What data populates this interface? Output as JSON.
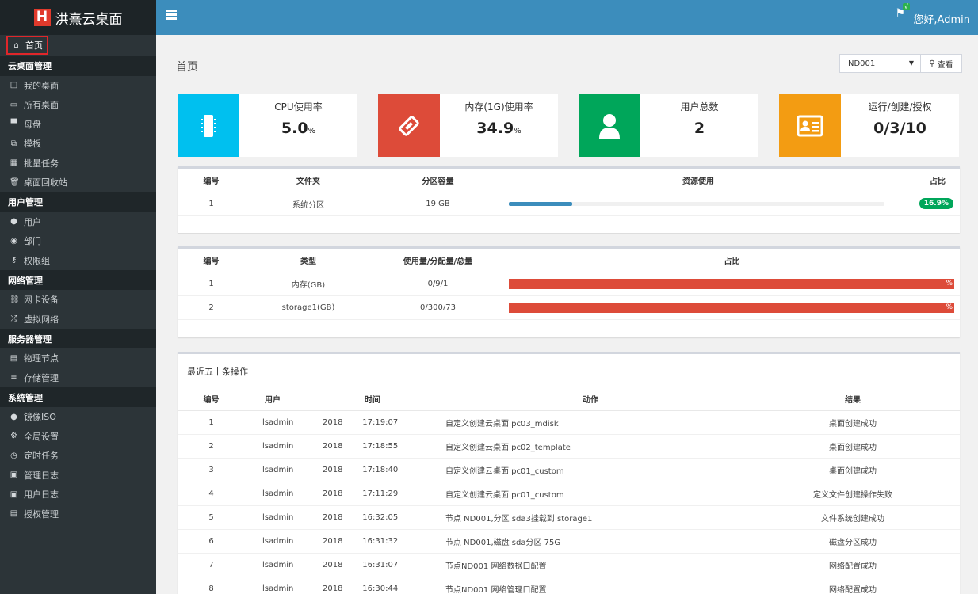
{
  "brand": {
    "logo": "H",
    "name": "洪熹云桌面"
  },
  "sidebar": {
    "home": "首页",
    "groups": [
      {
        "title": "云桌面管理",
        "items": [
          {
            "icon": "□",
            "label": "我的桌面"
          },
          {
            "icon": "▭",
            "label": "所有桌面"
          },
          {
            "icon": "▀",
            "label": "母盘"
          },
          {
            "icon": "⧉",
            "label": "模板"
          },
          {
            "icon": "▦",
            "label": "批量任务"
          },
          {
            "icon": "🗑",
            "label": "桌面回收站"
          }
        ]
      },
      {
        "title": "用户管理",
        "items": [
          {
            "icon": "●",
            "label": "用户"
          },
          {
            "icon": "◉",
            "label": "部门"
          },
          {
            "icon": "⚷",
            "label": "权限组"
          }
        ]
      },
      {
        "title": "网络管理",
        "items": [
          {
            "icon": "⛓",
            "label": "网卡设备"
          },
          {
            "icon": "⤮",
            "label": "虚拟网络"
          }
        ]
      },
      {
        "title": "服务器管理",
        "items": [
          {
            "icon": "▤",
            "label": "物理节点"
          },
          {
            "icon": "≡",
            "label": "存储管理"
          }
        ]
      },
      {
        "title": "系统管理",
        "items": [
          {
            "icon": "●",
            "label": "镜像ISO"
          },
          {
            "icon": "⚙",
            "label": "全局设置"
          },
          {
            "icon": "◷",
            "label": "定时任务"
          },
          {
            "icon": "▣",
            "label": "管理日志"
          },
          {
            "icon": "▣",
            "label": "用户日志"
          },
          {
            "icon": "▤",
            "label": "授权管理"
          }
        ]
      }
    ]
  },
  "topbar": {
    "greeting": "您好,Admin",
    "badge": "√"
  },
  "page": {
    "title": "首页",
    "node": "ND001",
    "view_button": "查看"
  },
  "stats": {
    "cpu": {
      "label": "CPU使用率",
      "value": "5.0",
      "unit": "%"
    },
    "mem": {
      "label": "内存(1G)使用率",
      "value": "34.9",
      "unit": "%"
    },
    "users": {
      "label": "用户总数",
      "value": "2"
    },
    "desktops": {
      "label": "运行/创建/授权",
      "value": "0/3/10"
    }
  },
  "colors": {
    "cpu": "#00c0ef",
    "mem": "#dd4b39",
    "users": "#00a65a",
    "desktops": "#f39c12"
  },
  "partitions": {
    "headers": [
      "编号",
      "文件夹",
      "分区容量",
      "资源使用",
      "占比"
    ],
    "rows": [
      {
        "no": "1",
        "folder": "系统分区",
        "capacity": "19 GB",
        "usage": 0.169,
        "pct": "16.9%"
      }
    ]
  },
  "resources": {
    "headers": [
      "编号",
      "类型",
      "使用量/分配量/总量",
      "占比"
    ],
    "rows": [
      {
        "no": "1",
        "type": "内存(GB)",
        "amounts": "0/9/1",
        "pct": "%"
      },
      {
        "no": "2",
        "type": "storage1(GB)",
        "amounts": "0/300/73",
        "pct": "%"
      }
    ]
  },
  "operations": {
    "title": "最近五十条操作",
    "headers": [
      "编号",
      "用户",
      "时间",
      "动作",
      "结果"
    ],
    "rows": [
      {
        "no": "1",
        "user": "lsadmin",
        "year": "2018",
        "time": "17:19:07",
        "action": "自定义创建云桌面 pc03_mdisk",
        "result": "桌面创建成功"
      },
      {
        "no": "2",
        "user": "lsadmin",
        "year": "2018",
        "time": "17:18:55",
        "action": "自定义创建云桌面 pc02_template",
        "result": "桌面创建成功"
      },
      {
        "no": "3",
        "user": "lsadmin",
        "year": "2018",
        "time": "17:18:40",
        "action": "自定义创建云桌面 pc01_custom",
        "result": "桌面创建成功"
      },
      {
        "no": "4",
        "user": "lsadmin",
        "year": "2018",
        "time": "17:11:29",
        "action": "自定义创建云桌面 pc01_custom",
        "result": "定义文件创建操作失败"
      },
      {
        "no": "5",
        "user": "lsadmin",
        "year": "2018",
        "time": "16:32:05",
        "action": "节点 ND001,分区 sda3挂载到 storage1",
        "result": "文件系统创建成功"
      },
      {
        "no": "6",
        "user": "lsadmin",
        "year": "2018",
        "time": "16:31:32",
        "action": "节点 ND001,磁盘 sda分区 75G",
        "result": "磁盘分区成功"
      },
      {
        "no": "7",
        "user": "lsadmin",
        "year": "2018",
        "time": "16:31:07",
        "action": "节点ND001 网络数据口配置",
        "result": "网络配置成功"
      },
      {
        "no": "8",
        "user": "lsadmin",
        "year": "2018",
        "time": "16:30:44",
        "action": "节点ND001 网络管理口配置",
        "result": "网络配置成功"
      }
    ]
  }
}
